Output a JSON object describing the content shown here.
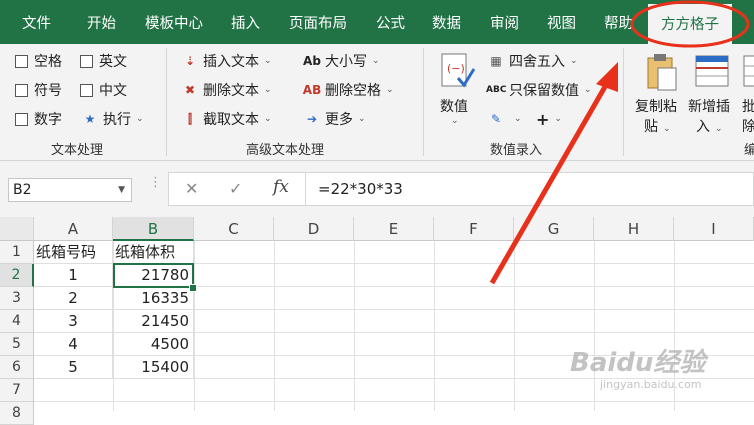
{
  "tabs": [
    "文件",
    "开始",
    "模板中心",
    "插入",
    "页面布局",
    "公式",
    "数据",
    "审阅",
    "视图",
    "帮助",
    "方方格子"
  ],
  "active_tab": "方方格子",
  "ribbon": {
    "text_group": {
      "label": "文本处理",
      "checks": [
        "空格",
        "英文",
        "符号",
        "中文",
        "数字"
      ],
      "execute": "执行"
    },
    "adv_group": {
      "label": "高级文本处理",
      "insert_text": "插入文本",
      "delete_text": "删除文本",
      "extract_text": "截取文本",
      "case": "大小写",
      "case_icon_text": "Ab",
      "del_space": "删除空格",
      "del_space_icon_text": "AB",
      "more": "更多"
    },
    "value_group": {
      "label": "数值录入",
      "value": "数值",
      "round": "四舍五入",
      "keep_value": "只保留数值",
      "keep_icon_text": "ABC",
      "plus": "+"
    },
    "edit_group": {
      "copy_paste_1": "复制粘",
      "copy_paste_2": "贴",
      "new_insert_1": "新增插",
      "new_insert_2": "入",
      "batch_1": "批",
      "batch_2": "除",
      "partial_label": "编"
    }
  },
  "formula_bar": {
    "name_box": "B2",
    "cancel": "✕",
    "enter": "✓",
    "fx": "fx",
    "formula": "=22*30*33"
  },
  "grid": {
    "columns": [
      "A",
      "B",
      "C",
      "D",
      "E",
      "F",
      "G",
      "H",
      "I"
    ],
    "rows": [
      "1",
      "2",
      "3",
      "4",
      "5",
      "6",
      "7",
      "8"
    ],
    "header_row": [
      "纸箱号码",
      "纸箱体积"
    ],
    "data": [
      {
        "a": "1",
        "b": "21780"
      },
      {
        "a": "2",
        "b": "16335"
      },
      {
        "a": "3",
        "b": "21450"
      },
      {
        "a": "4",
        "b": "4500"
      },
      {
        "a": "5",
        "b": "15400"
      }
    ],
    "selected_cell": "B2"
  },
  "watermark": {
    "brand": "Baidu经验",
    "url": "jingyan.baidu.com"
  },
  "colors": {
    "excel_green": "#217346",
    "annotation_red": "#e8311b"
  }
}
